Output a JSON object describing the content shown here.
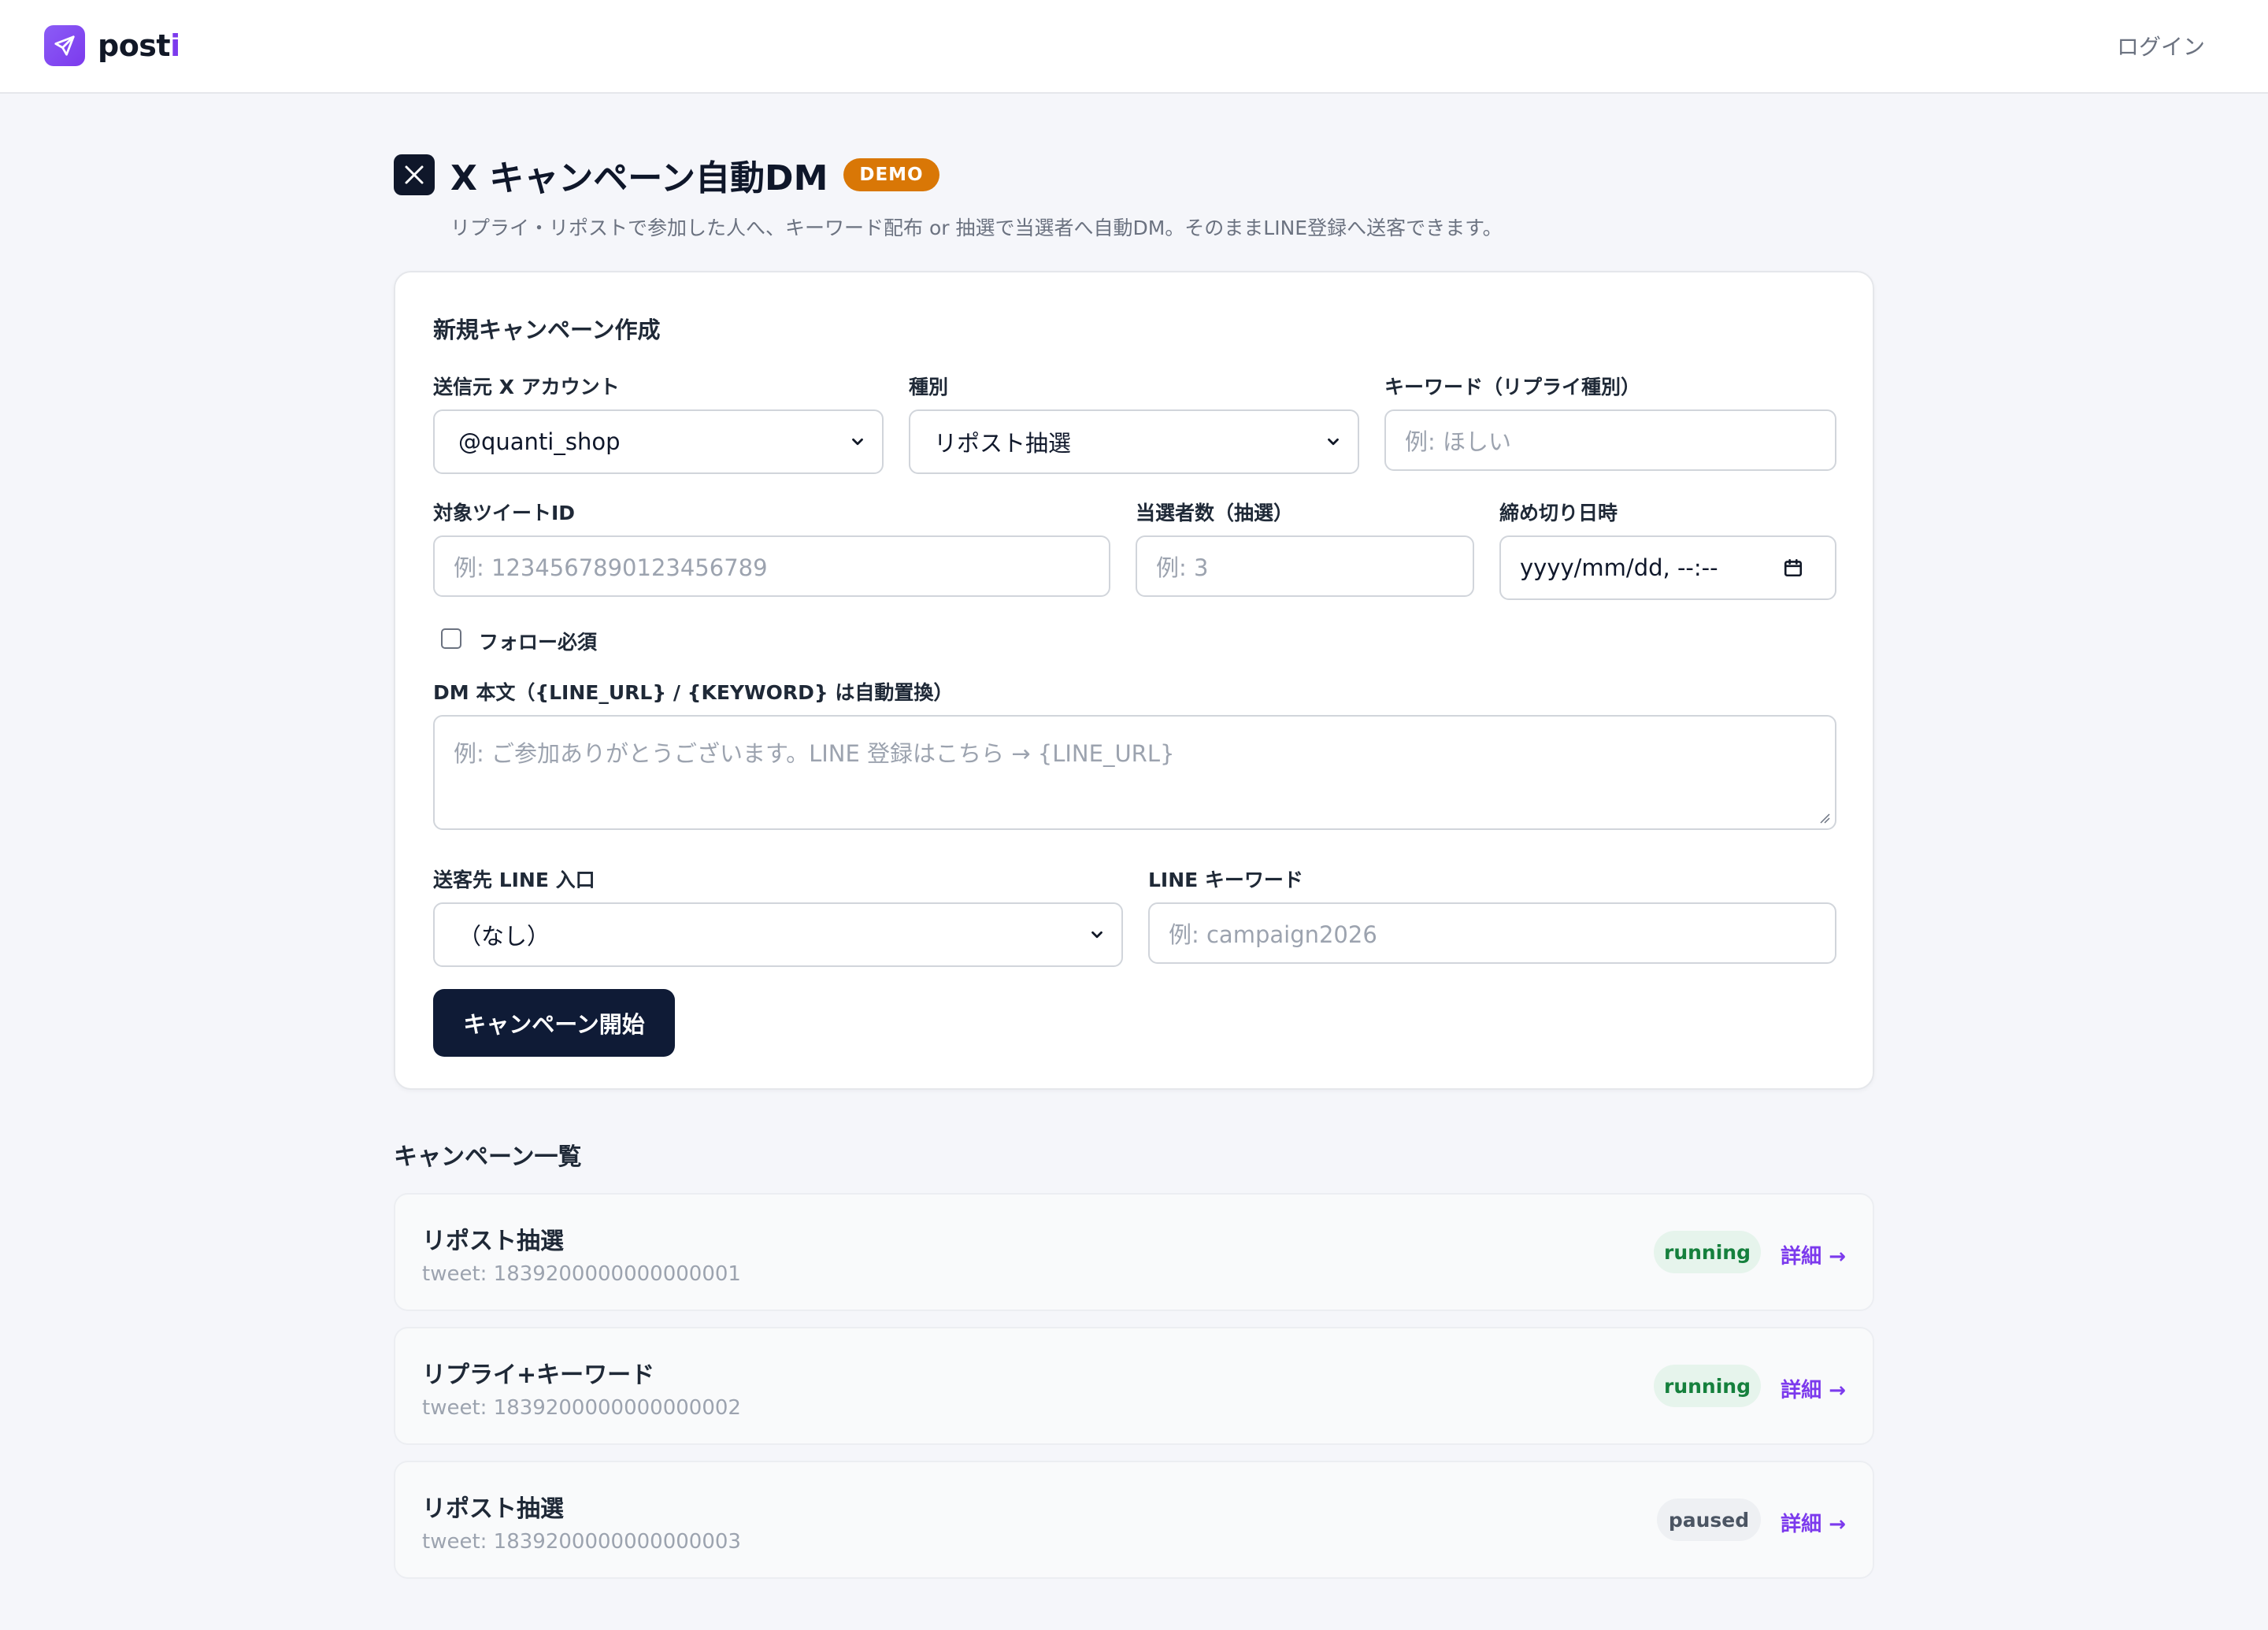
{
  "header": {
    "logo_text_main": "post",
    "logo_text_accent": "i",
    "login_label": "ログイン"
  },
  "page": {
    "x_icon": "x-logo-icon",
    "title": "X キャンペーン自動DM",
    "badge": "DEMO",
    "subtitle": "リプライ・リポストで参加した人へ、キーワード配布 or 抽選で当選者へ自動DM。そのままLINE登録へ送客できます。"
  },
  "form": {
    "title": "新規キャンペーン作成",
    "account_label": "送信元 X アカウント",
    "account_value": "@quanti_shop",
    "type_label": "種別",
    "type_value": "リポスト抽選",
    "keyword_label": "キーワード（リプライ種別）",
    "keyword_placeholder": "例: ほしい",
    "tweet_id_label": "対象ツイートID",
    "tweet_id_placeholder": "例: 1234567890123456789",
    "winners_label": "当選者数（抽選）",
    "winners_placeholder": "例: 3",
    "deadline_label": "締め切り日時",
    "deadline_placeholder": "yyyy/mm/dd, --:--",
    "follow_label": "フォロー必須",
    "dm_body_label": "DM 本文（{LINE_URL} / {KEYWORD} は自動置換）",
    "dm_body_placeholder": "例: ご参加ありがとうございます。LINE 登録はこちら → {LINE_URL}",
    "line_entry_label": "送客先 LINE 入口",
    "line_entry_value": "（なし）",
    "line_keyword_label": "LINE キーワード",
    "line_keyword_placeholder": "例: campaign2026",
    "submit_label": "キャンペーン開始"
  },
  "list": {
    "title": "キャンペーン一覧",
    "items": [
      {
        "name": "リポスト抽選",
        "tweet": "tweet: 1839200000000000001",
        "status": "running",
        "detail": "詳細 →"
      },
      {
        "name": "リプライ+キーワード",
        "tweet": "tweet: 1839200000000000002",
        "status": "running",
        "detail": "詳細 →"
      },
      {
        "name": "リポスト抽選",
        "tweet": "tweet: 1839200000000000003",
        "status": "paused",
        "detail": "詳細 →"
      }
    ]
  },
  "colors": {
    "brand": "#7c3aed",
    "primary_button": "#0f1b36",
    "demo_badge": "#d97706",
    "running": "#15803d",
    "paused": "#4b5563"
  }
}
